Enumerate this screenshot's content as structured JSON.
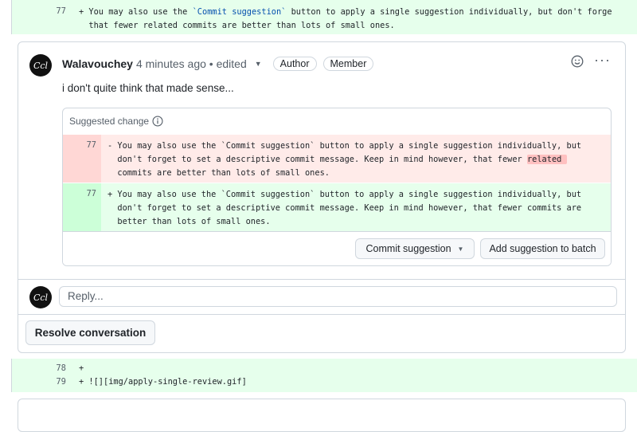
{
  "top_diff": {
    "line_number": "77",
    "line1_prefix": "+ You may also use the ",
    "line1_code": "`Commit suggestion`",
    "line1_suffix": " button to apply a single suggestion individually, but don't forge",
    "line2": "that fewer related commits are better than lots of small ones."
  },
  "comment": {
    "avatar_text": "Ccl",
    "author": "Walavouchey",
    "meta": "4 minutes ago • edited",
    "badges": [
      "Author",
      "Member"
    ],
    "more": "···",
    "body": "i don't quite think that made sense..."
  },
  "suggested_change": {
    "label": "Suggested change",
    "deleted": {
      "line_number": "77",
      "line1": "- You may also use the `Commit suggestion` button to apply a single suggestion individually, but",
      "line2": "don't forget to set a descriptive commit message. Keep in mind however, that fewer ",
      "highlight": "related ",
      "line3": "commits are better than lots of small ones."
    },
    "added": {
      "line_number": "77",
      "line1": "+ You may also use the `Commit suggestion` button to apply a single suggestion individually, but",
      "line2": "don't forget to set a descriptive commit message. Keep in mind however, that fewer commits are",
      "line3": "better than lots of small ones."
    },
    "commit_button": "Commit suggestion",
    "batch_button": "Add suggestion to batch"
  },
  "reply": {
    "placeholder": "Reply..."
  },
  "resolve_button": "Resolve conversation",
  "bottom_diff": {
    "lines": [
      {
        "number": "78",
        "code": "+"
      },
      {
        "number": "79",
        "code": "+ ![][img/apply-single-review.gif]"
      }
    ]
  }
}
